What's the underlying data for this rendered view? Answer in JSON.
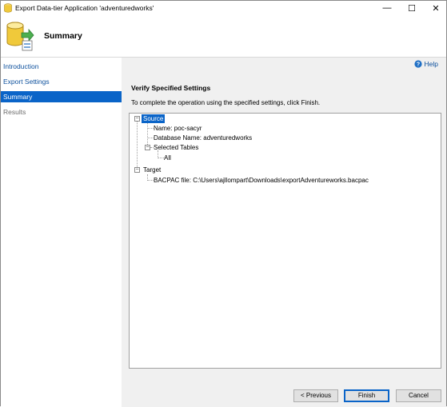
{
  "window": {
    "title": "Export Data-tier Application 'adventuredworks'",
    "controls": {
      "minimize": "—",
      "maximize": "☐",
      "close": "✕"
    }
  },
  "header": {
    "title": "Summary"
  },
  "sidebar": {
    "items": [
      {
        "label": "Introduction",
        "state": "link"
      },
      {
        "label": "Export Settings",
        "state": "link"
      },
      {
        "label": "Summary",
        "state": "active"
      },
      {
        "label": "Results",
        "state": "disabled"
      }
    ]
  },
  "main": {
    "help_label": "Help",
    "section_title": "Verify Specified Settings",
    "instructions": "To complete the operation using the specified settings, click Finish.",
    "tree": {
      "source": {
        "label": "Source",
        "name": "Name: poc-sacyr",
        "database": "Database Name: adventuredworks",
        "selected_tables": "Selected Tables",
        "all": "All"
      },
      "target": {
        "label": "Target",
        "bacpac": "BACPAC file: C:\\Users\\ajllompart\\Downloads\\exportAdventureworks.bacpac"
      }
    }
  },
  "buttons": {
    "previous": "< Previous",
    "finish": "Finish",
    "cancel": "Cancel"
  },
  "colors": {
    "accent": "#0a64c8",
    "link": "#0b4f9c"
  }
}
